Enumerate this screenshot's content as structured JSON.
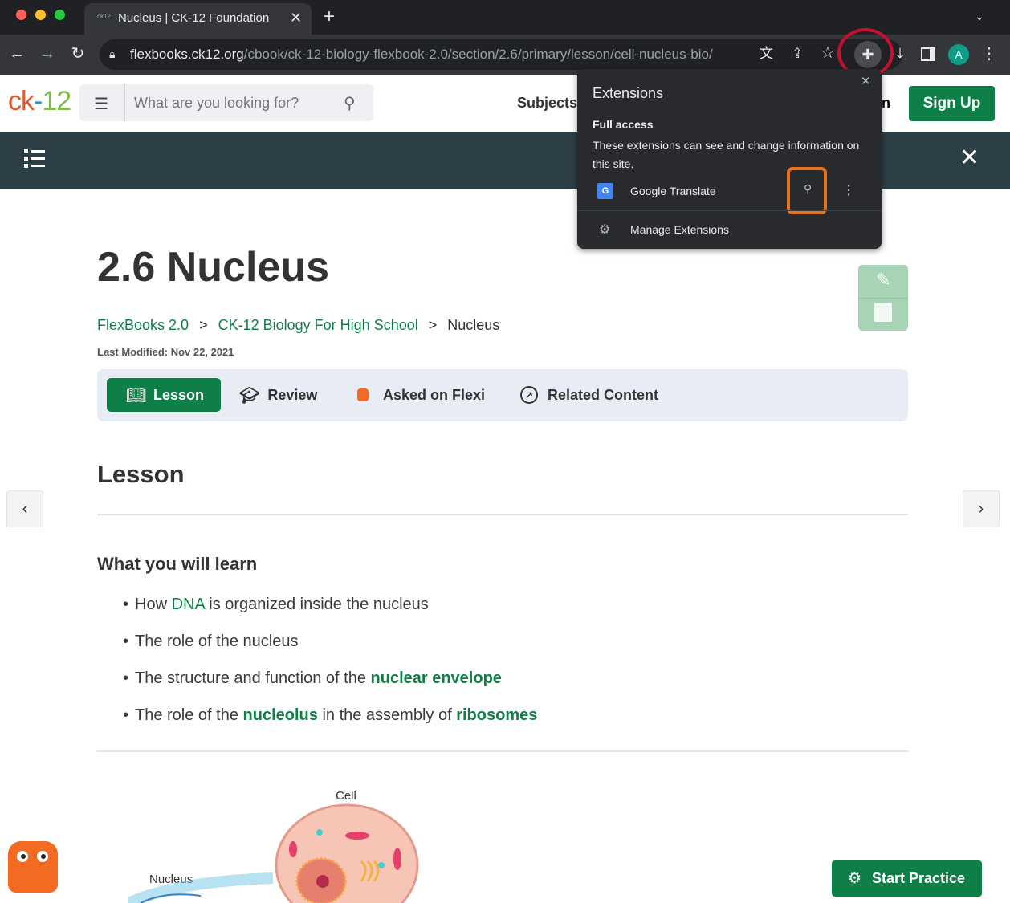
{
  "browser": {
    "tab_title": "Nucleus | CK-12 Foundation",
    "tab_favicon": "ck12",
    "url_host": "flexbooks.ck12.org",
    "url_path": "/cbook/ck-12-biology-flexbook-2.0/section/2.6/primary/lesson/cell-nucleus-bio/",
    "profile_initial": "A",
    "icons": [
      "back-icon",
      "forward-icon",
      "reload-icon",
      "lock-icon",
      "translate-icon",
      "share-icon",
      "star-icon",
      "puzzle-icon",
      "download-icon",
      "sidepanel-icon",
      "menu-icon",
      "close-icon",
      "plus-icon",
      "chevron-down-icon"
    ]
  },
  "site": {
    "logo_ck": "ck",
    "logo_dash": "-",
    "logo_12": "12",
    "search_placeholder": "What are you looking for?",
    "nav_subjects": "Subjects",
    "nav_partial": "n",
    "sign_up": "Sign Up"
  },
  "extensions_popup": {
    "title": "Extensions",
    "section_title": "Full access",
    "section_desc": "These extensions can see and change information on this site.",
    "extension_name": "Google Translate",
    "manage_label": "Manage Extensions"
  },
  "content": {
    "page_title": "2.6 Nucleus",
    "breadcrumb": [
      "FlexBooks 2.0",
      "CK-12 Biology For High School",
      "Nucleus"
    ],
    "breadcrumb_sep": ">",
    "last_modified": "Last Modified: Nov 22, 2021",
    "tabs": [
      "Lesson",
      "Review",
      "Asked on Flexi",
      "Related Content"
    ],
    "section_heading": "Lesson",
    "learn_heading": "What you will learn",
    "learn_items": [
      {
        "pre": "How ",
        "link": "DNA",
        "post": " is organized inside the nucleus"
      },
      {
        "text": "The role of the nucleus"
      },
      {
        "pre": "The structure and function of the ",
        "link": "nuclear envelope"
      },
      {
        "pre": "The role of the ",
        "link": "nucleolus",
        "mid": " in the assembly of ",
        "link2": "ribosomes"
      }
    ],
    "figure_labels": {
      "cell": "Cell",
      "nucleus": "Nucleus"
    },
    "start_practice": "Start Practice"
  },
  "colors": {
    "brand_green": "#0d7f47",
    "dark_bar": "#2c3e46",
    "highlight_red": "#c8102e",
    "highlight_orange": "#e8731a"
  }
}
